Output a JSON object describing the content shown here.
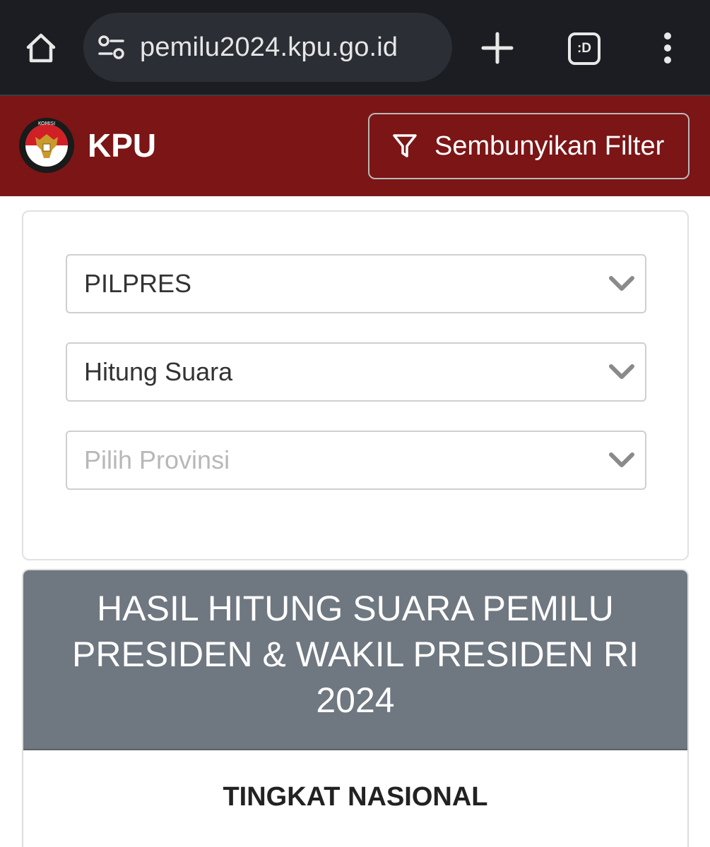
{
  "browser": {
    "url": "pemilu2024.kpu.go.id",
    "tabs_label": ":D",
    "icons": [
      "home-icon",
      "site-settings-icon",
      "new-tab-icon",
      "tab-switcher-icon",
      "more-vert-icon"
    ]
  },
  "header": {
    "brand": "KPU",
    "logo_icon": "kpu-logo",
    "filter_button_label": "Sembunyikan Filter",
    "colors": {
      "background": "#7b1516"
    }
  },
  "filters": [
    {
      "value": "PILPRES",
      "placeholder": false
    },
    {
      "value": "Hitung Suara",
      "placeholder": false
    },
    {
      "value": "Pilih Provinsi",
      "placeholder": true
    }
  ],
  "result": {
    "title_lines": [
      "HASIL HITUNG SUARA PEMILU",
      "PRESIDEN & WAKIL PRESIDEN RI",
      "2024"
    ],
    "level": "TINGKAT NASIONAL",
    "colors": {
      "header_background": "#6f7780"
    }
  }
}
